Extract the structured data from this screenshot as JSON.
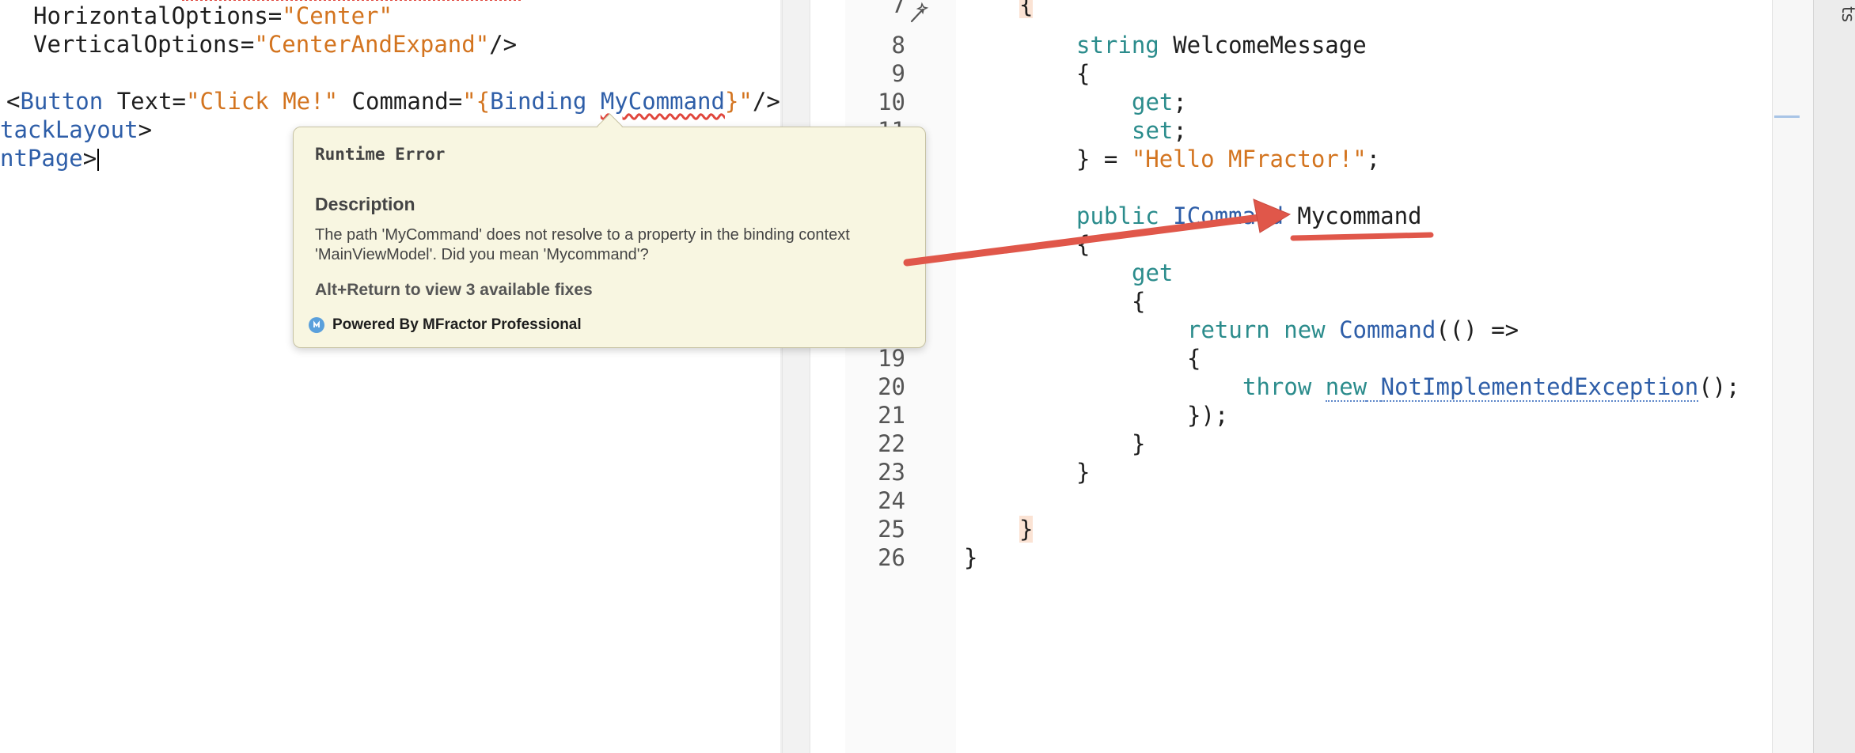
{
  "xaml_editor": {
    "lines": [
      {
        "name": "xaml-horizontal-options",
        "tokens": [
          {
            "text": "HorizontalOptions=",
            "kind": "attr"
          },
          {
            "text": "\"Center\"",
            "kind": "str"
          }
        ]
      },
      {
        "name": "xaml-vertical-options",
        "tokens": [
          {
            "text": "VerticalOptions=",
            "kind": "attr"
          },
          {
            "text": "\"CenterAndExpand\"",
            "kind": "str"
          },
          {
            "text": "/>",
            "kind": "plain"
          }
        ]
      },
      {
        "name": "xaml-button",
        "tokens": [
          {
            "text": "<",
            "kind": "plain"
          },
          {
            "text": "Button",
            "kind": "tag"
          },
          {
            "text": " Text=",
            "kind": "attr"
          },
          {
            "text": "\"Click Me!\"",
            "kind": "str"
          },
          {
            "text": " Command=",
            "kind": "attr"
          },
          {
            "text": "\"{",
            "kind": "str"
          },
          {
            "text": "Binding ",
            "kind": "tag"
          },
          {
            "text": "MyCommand",
            "kind": "tag-error"
          },
          {
            "text": "}\"",
            "kind": "str"
          },
          {
            "text": "/>",
            "kind": "plain"
          }
        ]
      },
      {
        "name": "xaml-stacklayout-close",
        "tokens": [
          {
            "text": "tackLayout",
            "kind": "tag"
          },
          {
            "text": ">",
            "kind": "plain"
          }
        ]
      },
      {
        "name": "xaml-contentpage-close",
        "tokens": [
          {
            "text": "ntPage",
            "kind": "tag"
          },
          {
            "text": ">",
            "kind": "plain"
          }
        ]
      }
    ]
  },
  "csharp_editor": {
    "line_numbers": [
      "7",
      "8",
      "9",
      "10",
      "11",
      "19",
      "20",
      "21",
      "22",
      "23",
      "24",
      "25",
      "26"
    ],
    "lines": [
      {
        "name": "cs-open-brace-class",
        "tokens": [
          {
            "text": "{",
            "kind": "brace-hl"
          }
        ]
      },
      {
        "name": "cs-welcome-message-decl",
        "tokens": [
          {
            "text": "string",
            "kind": "kw"
          },
          {
            "text": " WelcomeMessage",
            "kind": "plain"
          }
        ]
      },
      {
        "name": "cs-prop-open-brace",
        "tokens": [
          {
            "text": "{",
            "kind": "plain"
          }
        ]
      },
      {
        "name": "cs-get",
        "tokens": [
          {
            "text": "get",
            "kind": "kw"
          },
          {
            "text": ";",
            "kind": "plain"
          }
        ]
      },
      {
        "name": "cs-set",
        "tokens": [
          {
            "text": "set",
            "kind": "kw"
          },
          {
            "text": ";",
            "kind": "plain"
          }
        ]
      },
      {
        "name": "cs-initializer",
        "tokens": [
          {
            "text": "} = ",
            "kind": "plain"
          },
          {
            "text": "\"Hello MFractor!\"",
            "kind": "str"
          },
          {
            "text": ";",
            "kind": "plain"
          }
        ]
      },
      {
        "name": "cs-mycommand-decl",
        "tokens": [
          {
            "text": "public",
            "kind": "kw"
          },
          {
            "text": " ",
            "kind": "plain"
          },
          {
            "text": "ICommand",
            "kind": "type"
          },
          {
            "text": " Mycommand",
            "kind": "plain"
          }
        ]
      },
      {
        "name": "cs-cmd-open-brace",
        "tokens": [
          {
            "text": "{",
            "kind": "plain"
          }
        ]
      },
      {
        "name": "cs-cmd-get",
        "tokens": [
          {
            "text": "get",
            "kind": "kw"
          }
        ]
      },
      {
        "name": "cs-get-open-brace",
        "tokens": [
          {
            "text": "{",
            "kind": "plain"
          }
        ]
      },
      {
        "name": "cs-return",
        "tokens": [
          {
            "text": "return",
            "kind": "kw"
          },
          {
            "text": " ",
            "kind": "plain"
          },
          {
            "text": "new",
            "kind": "kw"
          },
          {
            "text": " ",
            "kind": "plain"
          },
          {
            "text": "Command",
            "kind": "type"
          },
          {
            "text": "(() =>",
            "kind": "plain"
          }
        ]
      },
      {
        "name": "cs-lambda-open",
        "tokens": [
          {
            "text": "{",
            "kind": "plain"
          }
        ]
      },
      {
        "name": "cs-throw",
        "tokens": [
          {
            "text": "throw",
            "kind": "kw"
          },
          {
            "text": " ",
            "kind": "plain"
          },
          {
            "text": "new",
            "kind": "kw-dotted"
          },
          {
            "text": " ",
            "kind": "plain-dotted"
          },
          {
            "text": "NotImplementedException",
            "kind": "type-dotted"
          },
          {
            "text": "();",
            "kind": "plain"
          }
        ]
      },
      {
        "name": "cs-lambda-close",
        "tokens": [
          {
            "text": "});",
            "kind": "plain"
          }
        ]
      },
      {
        "name": "cs-get-close",
        "tokens": [
          {
            "text": "}",
            "kind": "plain"
          }
        ]
      },
      {
        "name": "cs-prop-close",
        "tokens": [
          {
            "text": "}",
            "kind": "plain"
          }
        ]
      },
      {
        "name": "cs-class-close",
        "tokens": [
          {
            "text": "}",
            "kind": "brace-hl"
          }
        ]
      },
      {
        "name": "cs-namespace-close",
        "tokens": [
          {
            "text": "}",
            "kind": "plain"
          }
        ]
      }
    ]
  },
  "tooltip": {
    "title": "Runtime Error",
    "heading": "Description",
    "description": "The path 'MyCommand' does not resolve to a property in the binding context 'MainViewModel'. Did you mean 'Mycommand'?",
    "fixes_hint": "Alt+Return to view 3 available fixes",
    "footer": "Powered By MFractor Professional",
    "footer_icon": "mfractor-logo-icon"
  },
  "side_panel": {
    "label": "ts"
  },
  "colors": {
    "string": "#d3741f",
    "tag": "#2e5ea8",
    "keyword": "#2b8c8c",
    "error_squiggle": "#e0463c",
    "annotation_arrow": "#e0574a",
    "tooltip_bg": "#f8f6e1"
  }
}
